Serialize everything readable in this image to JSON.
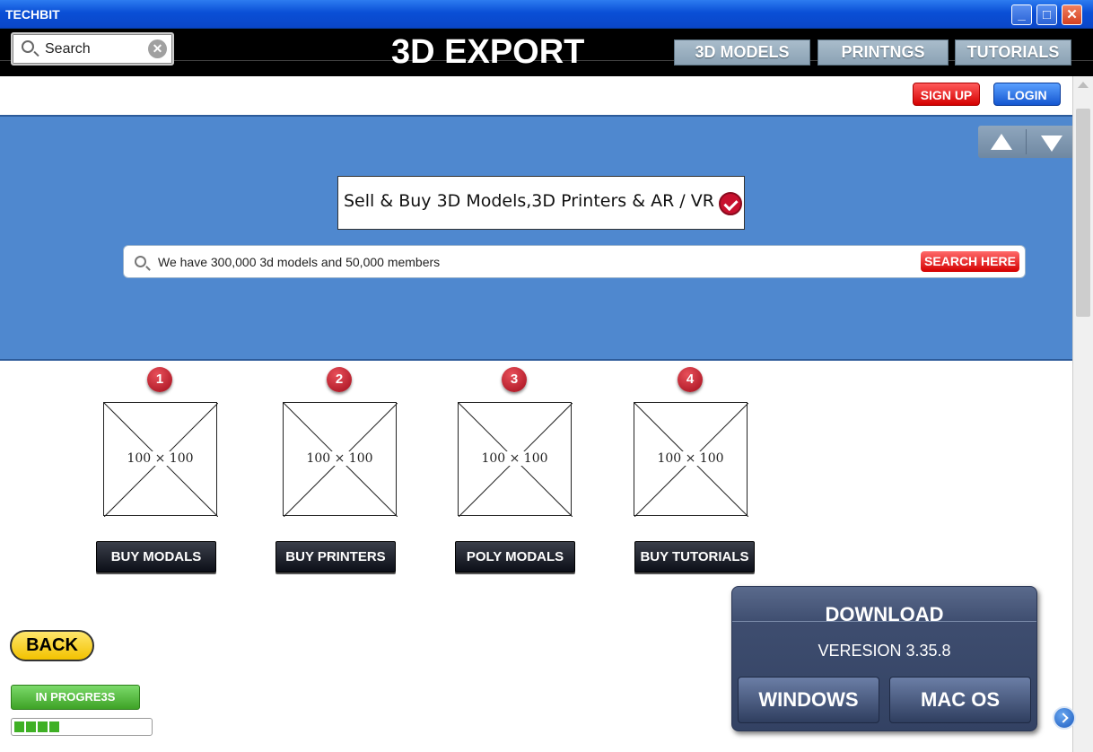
{
  "window": {
    "title": "TECHBIT"
  },
  "topnav": {
    "search_placeholder": "Search",
    "brand": "3D EXPORT",
    "links": [
      "3D MODELS",
      "PRINTNGS",
      "TUTORIALS"
    ]
  },
  "auth": {
    "signup": "SIGN UP",
    "login": "LOGIN"
  },
  "hero": {
    "tagline": "Sell & Buy 3D Models,3D Printers & AR / VR",
    "search_placeholder": "We have 300,000 3d models and 50,000 members",
    "search_button": "SEARCH HERE"
  },
  "cards": [
    {
      "number": "1",
      "image_label": "100 × 100",
      "button": "BUY MODALS"
    },
    {
      "number": "2",
      "image_label": "100 × 100",
      "button": "BUY PRINTERS"
    },
    {
      "number": "3",
      "image_label": "100 × 100",
      "button": "POLY MODALS"
    },
    {
      "number": "4",
      "image_label": "100 × 100",
      "button": "BUY TUTORIALS"
    }
  ],
  "back_button": "BACK",
  "progress": {
    "label": "IN PROGRE3S",
    "fraction": 0.33
  },
  "download": {
    "title": "DOWNLOAD",
    "version": "VERESION 3.35.8",
    "windows": "WINDOWS",
    "mac": "MAC OS"
  },
  "colors": {
    "hero": "#4f88cf",
    "signup": "#d40000",
    "login": "#1456d0",
    "titlebar": "#0a4fd6"
  }
}
